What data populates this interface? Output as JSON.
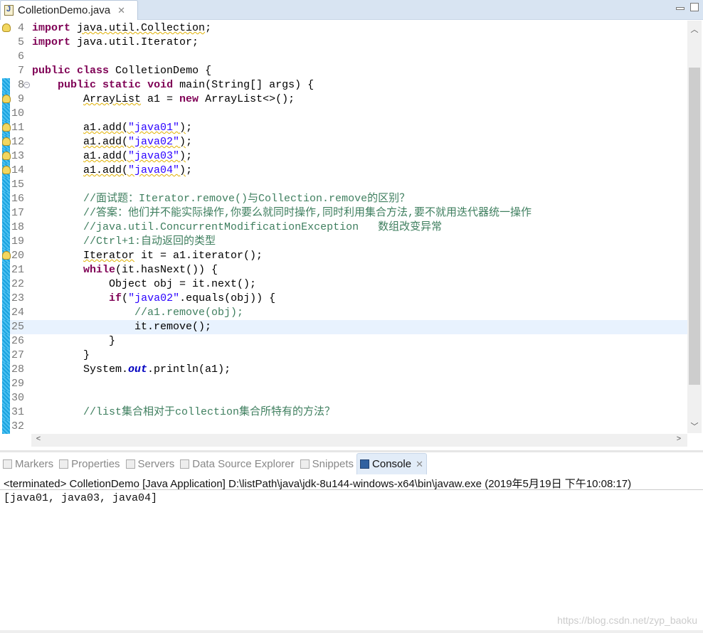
{
  "editor_tab": {
    "title": "ColletionDemo.java",
    "icon": "java-file-icon"
  },
  "code_lines": [
    {
      "n": "4",
      "warn": true,
      "mark": false,
      "t": [
        [
          "k",
          "import"
        ],
        [
          "p",
          " "
        ],
        [
          "pw",
          "java.util.Collection"
        ],
        [
          "p",
          ";"
        ]
      ]
    },
    {
      "n": "5",
      "t": [
        [
          "k",
          "import"
        ],
        [
          "p",
          " java.util.Iterator;"
        ]
      ]
    },
    {
      "n": "6",
      "t": []
    },
    {
      "n": "7",
      "t": [
        [
          "k",
          "public"
        ],
        [
          "p",
          " "
        ],
        [
          "k",
          "class"
        ],
        [
          "p",
          " ColletionDemo {"
        ]
      ]
    },
    {
      "n": "8",
      "mark": true,
      "fold": true,
      "t": [
        [
          "p",
          "    "
        ],
        [
          "k",
          "public"
        ],
        [
          "p",
          " "
        ],
        [
          "k",
          "static"
        ],
        [
          "p",
          " "
        ],
        [
          "k",
          "void"
        ],
        [
          "p",
          " main(String[] args) {"
        ]
      ]
    },
    {
      "n": "9",
      "mark": true,
      "warn": true,
      "t": [
        [
          "p",
          "        "
        ],
        [
          "pw",
          "ArrayList"
        ],
        [
          "p",
          " a1 = "
        ],
        [
          "k",
          "new"
        ],
        [
          "p",
          " ArrayList<>();"
        ]
      ]
    },
    {
      "n": "10",
      "mark": true,
      "t": []
    },
    {
      "n": "11",
      "mark": true,
      "warn": true,
      "t": [
        [
          "p",
          "        "
        ],
        [
          "pw",
          "a1.add(\"java01\")"
        ],
        [
          "p",
          ";"
        ]
      ]
    },
    {
      "n": "12",
      "mark": true,
      "warn": true,
      "t": [
        [
          "p",
          "        "
        ],
        [
          "pw",
          "a1.add(\"java02\")"
        ],
        [
          "p",
          ";"
        ]
      ]
    },
    {
      "n": "13",
      "mark": true,
      "warn": true,
      "t": [
        [
          "p",
          "        "
        ],
        [
          "pw",
          "a1.add(\"java03\")"
        ],
        [
          "p",
          ";"
        ]
      ]
    },
    {
      "n": "14",
      "mark": true,
      "warn": true,
      "t": [
        [
          "p",
          "        "
        ],
        [
          "pw",
          "a1.add(\"java04\")"
        ],
        [
          "p",
          ";"
        ]
      ]
    },
    {
      "n": "15",
      "mark": true,
      "t": []
    },
    {
      "n": "16",
      "mark": true,
      "t": [
        [
          "p",
          "        "
        ],
        [
          "c",
          "//面试题：Iterator.remove()与Collection.remove的区别？"
        ]
      ]
    },
    {
      "n": "17",
      "mark": true,
      "t": [
        [
          "p",
          "        "
        ],
        [
          "c",
          "//答案：他们并不能实际操作,你要么就同时操作,同时利用集合方法,要不就用迭代器统一操作"
        ]
      ]
    },
    {
      "n": "18",
      "mark": true,
      "t": [
        [
          "p",
          "        "
        ],
        [
          "c",
          "//java.util.ConcurrentModificationException   数组改变异常"
        ]
      ]
    },
    {
      "n": "19",
      "mark": true,
      "t": [
        [
          "p",
          "        "
        ],
        [
          "c",
          "//Ctrl+1:自动返回的类型"
        ]
      ]
    },
    {
      "n": "20",
      "mark": true,
      "warn": true,
      "t": [
        [
          "p",
          "        "
        ],
        [
          "pw",
          "Iterator"
        ],
        [
          "p",
          " it = a1.iterator();"
        ]
      ]
    },
    {
      "n": "21",
      "mark": true,
      "t": [
        [
          "p",
          "        "
        ],
        [
          "k",
          "while"
        ],
        [
          "p",
          "(it.hasNext()) {"
        ]
      ]
    },
    {
      "n": "22",
      "mark": true,
      "t": [
        [
          "p",
          "            Object obj = it.next();"
        ]
      ]
    },
    {
      "n": "23",
      "mark": true,
      "t": [
        [
          "p",
          "            "
        ],
        [
          "k",
          "if"
        ],
        [
          "p",
          "("
        ],
        [
          "s",
          "\"java02\""
        ],
        [
          "p",
          ".equals(obj)) {"
        ]
      ]
    },
    {
      "n": "24",
      "mark": true,
      "t": [
        [
          "p",
          "                "
        ],
        [
          "c",
          "//a1.remove(obj);"
        ]
      ]
    },
    {
      "n": "25",
      "mark": true,
      "cur": true,
      "t": [
        [
          "p",
          "                it.remove();"
        ]
      ]
    },
    {
      "n": "26",
      "mark": true,
      "t": [
        [
          "p",
          "            }"
        ]
      ]
    },
    {
      "n": "27",
      "mark": true,
      "t": [
        [
          "p",
          "        }"
        ]
      ]
    },
    {
      "n": "28",
      "mark": true,
      "t": [
        [
          "p",
          "        System."
        ],
        [
          "i",
          "out"
        ],
        [
          "p",
          ".println(a1);"
        ]
      ]
    },
    {
      "n": "29",
      "mark": true,
      "t": []
    },
    {
      "n": "30",
      "mark": true,
      "t": []
    },
    {
      "n": "31",
      "mark": true,
      "t": [
        [
          "p",
          "        "
        ],
        [
          "c",
          "//list集合相对于collection集合所特有的方法？"
        ]
      ]
    },
    {
      "n": "32",
      "mark": true,
      "t": []
    }
  ],
  "bottom_tabs": [
    {
      "label": "Markers",
      "icon": "markers-icon"
    },
    {
      "label": "Properties",
      "icon": "properties-icon"
    },
    {
      "label": "Servers",
      "icon": "servers-icon"
    },
    {
      "label": "Data Source Explorer",
      "icon": "data-source-icon"
    },
    {
      "label": "Snippets",
      "icon": "snippets-icon"
    },
    {
      "label": "Console",
      "icon": "console-icon",
      "active": true
    }
  ],
  "console": {
    "info": "<terminated> ColletionDemo [Java Application] D:\\listPath\\java\\jdk-8u144-windows-x64\\bin\\javaw.exe (2019年5月19日 下午10:08:17)",
    "output": "[java01, java03, java04]"
  },
  "watermark": "https://blog.csdn.net/zyp_baoku",
  "colors": {
    "keyword": "#7f0055",
    "string": "#2a00ff",
    "comment": "#3f7f5f",
    "line_number": "#787878"
  }
}
